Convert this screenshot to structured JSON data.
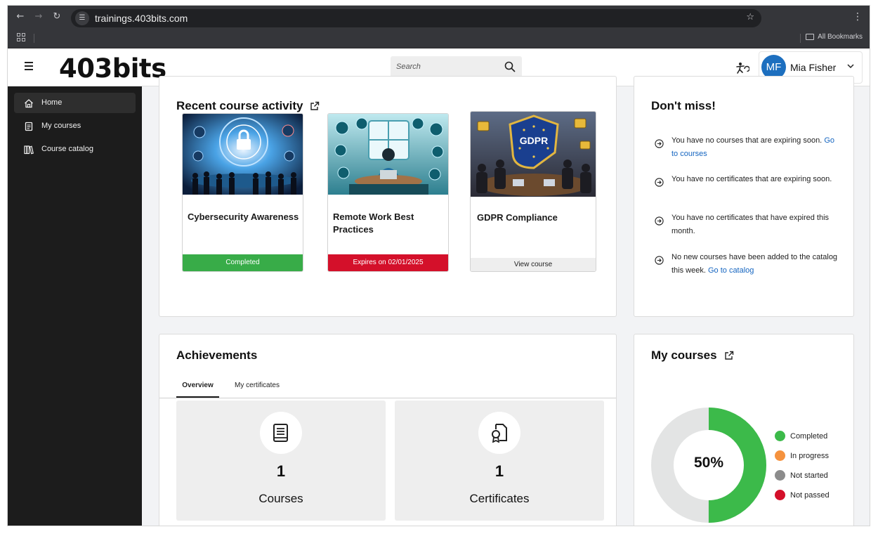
{
  "browser": {
    "url": "trainings.403bits.com",
    "all_bookmarks": "All Bookmarks"
  },
  "header": {
    "logo": "403bits",
    "search_placeholder": "Search",
    "user": {
      "initials": "MF",
      "name": "Mia Fisher",
      "avatar_color": "#1d6fbf"
    }
  },
  "sidebar": {
    "items": [
      {
        "label": "Home",
        "icon": "home-icon",
        "active": true
      },
      {
        "label": "My courses",
        "icon": "clipboard-icon",
        "active": false
      },
      {
        "label": "Course catalog",
        "icon": "books-icon",
        "active": false
      }
    ]
  },
  "recent_activity": {
    "title": "Recent course activity",
    "courses": [
      {
        "name": "Cybersecurity Awareness",
        "status": "Completed",
        "status_color": "#38ac48",
        "image": "cybersecurity-illustration"
      },
      {
        "name": "Remote Work Best Practices",
        "status": "Expires on 02/01/2025",
        "status_color": "#d4102a",
        "image": "remote-work-illustration"
      },
      {
        "name": "GDPR Compliance",
        "status": "View course",
        "status_color": "#eeeeee",
        "image": "gdpr-illustration",
        "image_label": "GDPR"
      }
    ]
  },
  "dont_miss": {
    "title": "Don't miss!",
    "items": [
      {
        "text": "You have no courses that are expiring soon.",
        "link": "Go to courses"
      },
      {
        "text": "You have no certificates that are expiring soon.",
        "link": ""
      },
      {
        "text": "You have no certificates that have expired this month.",
        "link": ""
      },
      {
        "text": "No new courses have been added to the catalog this week.",
        "link": "Go to catalog"
      }
    ]
  },
  "achievements": {
    "title": "Achievements",
    "tabs": [
      {
        "label": "Overview",
        "active": true
      },
      {
        "label": "My certificates",
        "active": false
      }
    ],
    "stats": [
      {
        "value": "1",
        "label": "Courses",
        "icon": "book-icon"
      },
      {
        "value": "1",
        "label": "Certificates",
        "icon": "certificate-icon"
      }
    ]
  },
  "my_courses": {
    "title": "My courses",
    "center_label": "50%",
    "completed_fraction": 0.5,
    "legend": [
      {
        "label": "Completed",
        "color": "#3cba4a"
      },
      {
        "label": "In progress",
        "color": "#f5923e"
      },
      {
        "label": "Not started",
        "color": "#8c8c8c"
      },
      {
        "label": "Not passed",
        "color": "#d4102a"
      }
    ],
    "track_color": "#e3e4e4"
  }
}
